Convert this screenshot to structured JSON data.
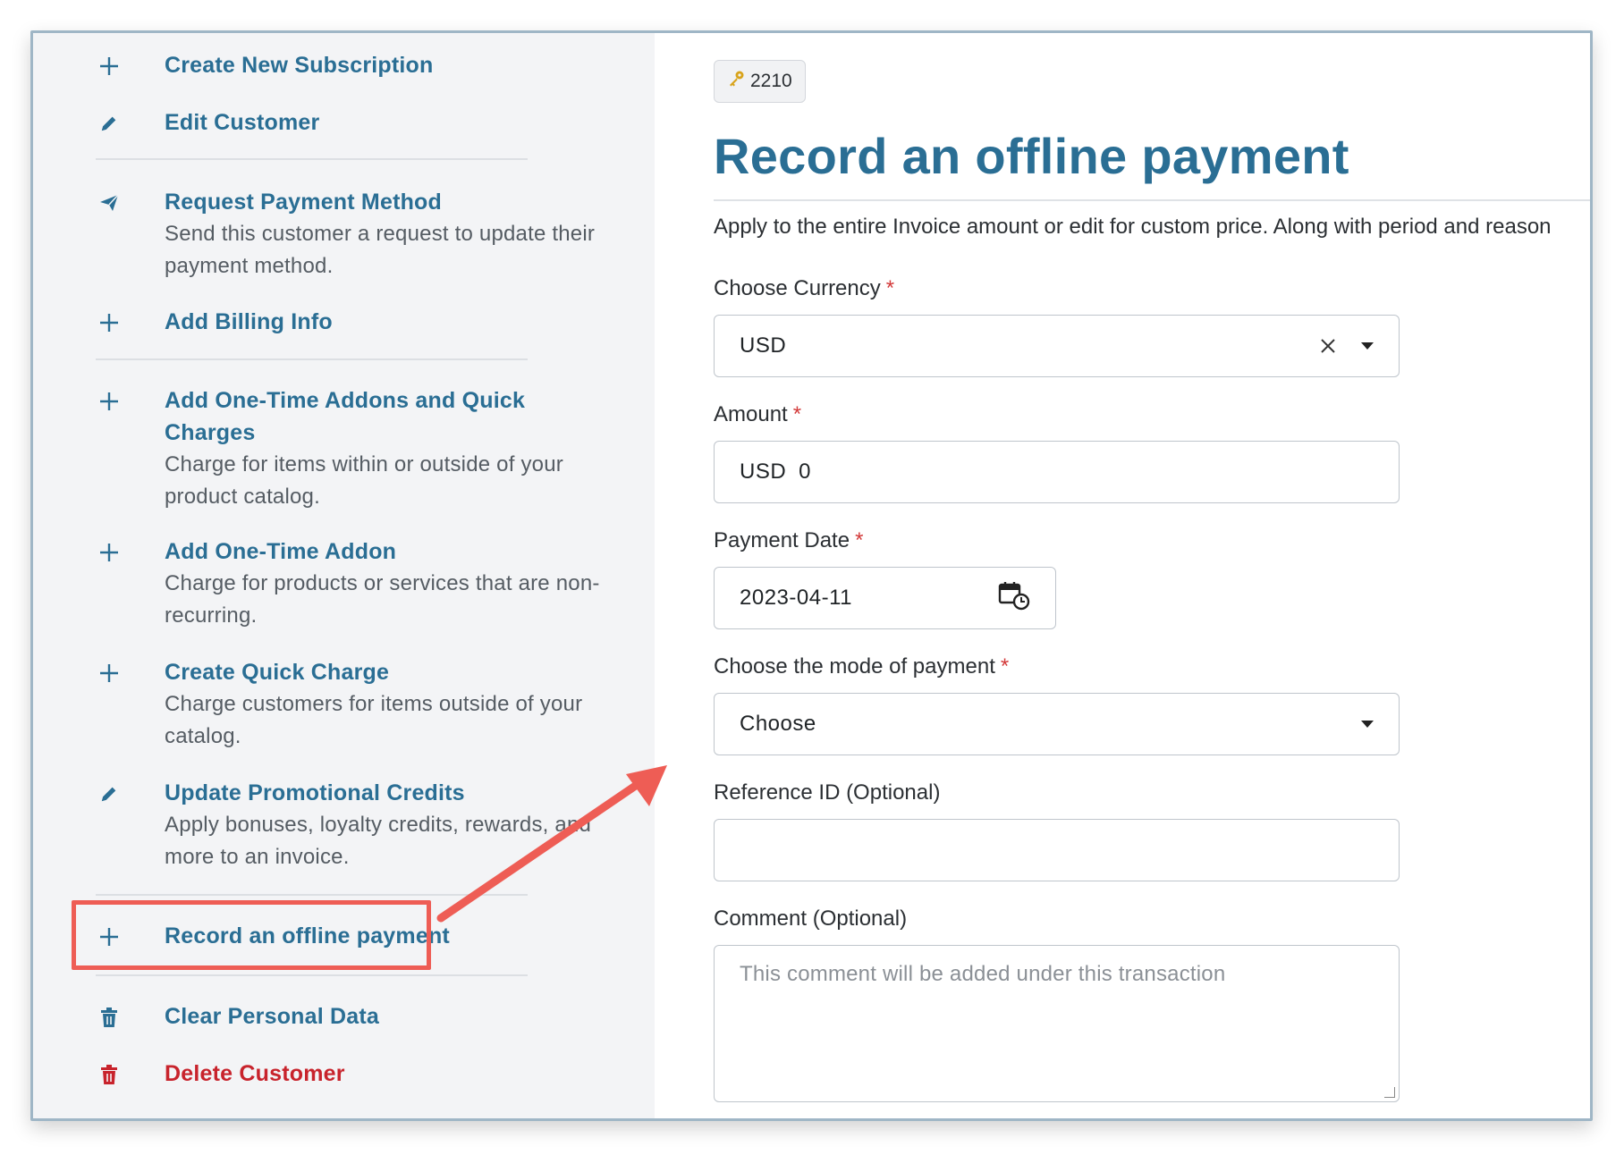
{
  "sidebar": {
    "items": [
      {
        "title": "Create New Subscription",
        "icon": "plus-icon"
      },
      {
        "title": "Edit Customer",
        "icon": "pencil-icon"
      },
      {
        "title": "Request Payment Method",
        "desc": "Send this customer a request to update their payment method.",
        "icon": "paper-plane-icon"
      },
      {
        "title": "Add Billing Info",
        "icon": "plus-icon"
      },
      {
        "title": "Add One-Time Addons and Quick Charges",
        "desc": "Charge for items within or outside of your product catalog.",
        "icon": "plus-icon"
      },
      {
        "title": "Add One-Time Addon",
        "desc": "Charge for products or services that are non-recurring.",
        "icon": "plus-icon"
      },
      {
        "title": "Create Quick Charge",
        "desc": "Charge customers for items outside of your catalog.",
        "icon": "plus-icon"
      },
      {
        "title": "Update Promotional Credits",
        "desc": "Apply bonuses, loyalty credits, rewards, and more to an invoice.",
        "icon": "pencil-icon"
      },
      {
        "title": "Record an offline payment",
        "icon": "plus-icon"
      },
      {
        "title": "Clear Personal Data",
        "icon": "trash-icon"
      },
      {
        "title": "Delete Customer",
        "icon": "trash-icon"
      }
    ]
  },
  "main": {
    "badge": "2210",
    "title": "Record an offline payment",
    "subtitle": "Apply to the entire Invoice amount or edit for custom price. Along with period and reason",
    "currency": {
      "label": "Choose Currency",
      "required": "*",
      "value": "USD"
    },
    "amount": {
      "label": "Amount",
      "required": "*",
      "currency": "USD",
      "value": "0"
    },
    "payment_date": {
      "label": "Payment Date",
      "required": "*",
      "value": "2023-04-11"
    },
    "mode": {
      "label": "Choose the mode of payment",
      "required": "*",
      "value": "Choose"
    },
    "reference": {
      "label": "Reference ID (Optional)",
      "value": ""
    },
    "comment": {
      "label": "Comment (Optional)",
      "placeholder": "This comment will be added under this transaction"
    }
  },
  "colors": {
    "accent": "#2a6e94",
    "danger": "#c8232c",
    "highlight": "#ee5d55",
    "required": "#d33a3a"
  }
}
